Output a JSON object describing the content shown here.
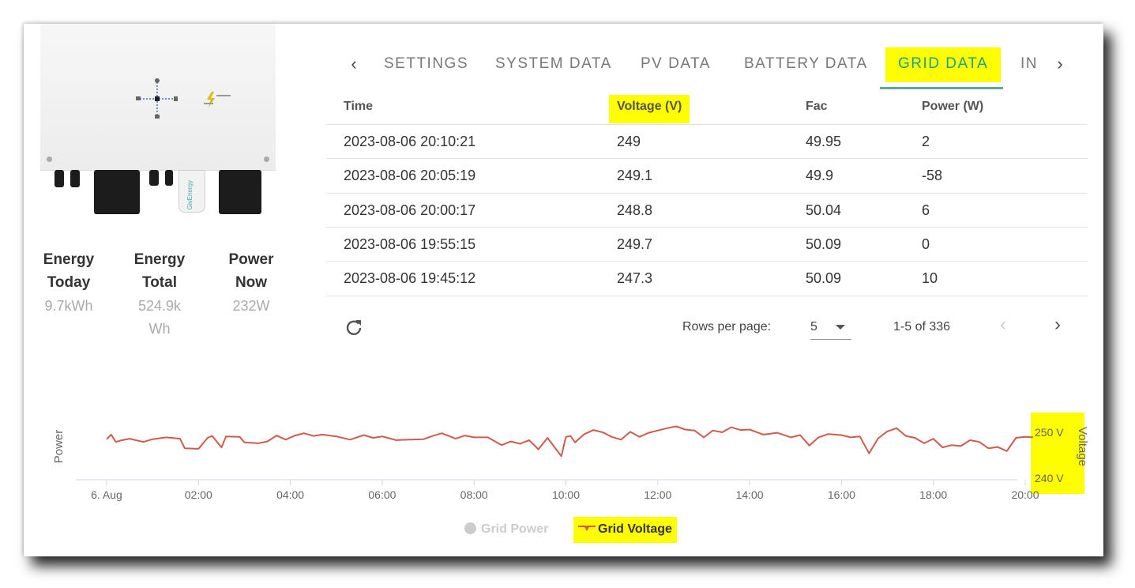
{
  "stats": [
    {
      "label_1": "Energy",
      "label_2": "Today",
      "value_1": "9.7kWh",
      "value_2": ""
    },
    {
      "label_1": "Energy",
      "label_2": "Total",
      "value_1": "524.9k",
      "value_2": "Wh"
    },
    {
      "label_1": "Power",
      "label_2": "Now",
      "value_1": "232W",
      "value_2": ""
    }
  ],
  "device": {
    "dongle_text": "GivEnergy"
  },
  "tabs": [
    "SETTINGS",
    "SYSTEM DATA",
    "PV DATA",
    "BATTERY DATA",
    "GRID DATA",
    "IN"
  ],
  "active_tab": "GRID DATA",
  "table": {
    "headers": [
      "Time",
      "Voltage (V)",
      "Fac",
      "Power (W)"
    ],
    "rows": [
      [
        "2023-08-06 20:10:21",
        "249",
        "49.95",
        "2"
      ],
      [
        "2023-08-06 20:05:19",
        "249.1",
        "49.9",
        "-58"
      ],
      [
        "2023-08-06 20:00:17",
        "248.8",
        "50.04",
        "6"
      ],
      [
        "2023-08-06 19:55:15",
        "249.7",
        "50.09",
        "0"
      ],
      [
        "2023-08-06 19:45:12",
        "247.3",
        "50.09",
        "10"
      ]
    ],
    "rows_per_page_label": "Rows per page:",
    "rows_per_page": "5",
    "range": "1-5 of 336"
  },
  "colors": {
    "accent": "#1aa391",
    "highlight": "#fffe00",
    "line": "#cd5c4f"
  },
  "chart_data": {
    "type": "line",
    "x_ticks": [
      "6. Aug",
      "02:00",
      "04:00",
      "06:00",
      "08:00",
      "10:00",
      "12:00",
      "14:00",
      "16:00",
      "18:00",
      "20:00"
    ],
    "y_left_label": "Power",
    "y_right_label": "Voltage",
    "y_right_ticks": [
      "250 V",
      "240 V"
    ],
    "y_right_range": [
      240,
      250
    ],
    "legend": [
      "Grid Power",
      "Grid Voltage"
    ],
    "series": [
      {
        "name": "Grid Voltage",
        "x_hours": [
          0,
          0.1,
          0.2,
          0.3,
          0.5,
          0.8,
          1,
          1.3,
          1.6,
          1.7,
          2.0,
          2.2,
          2.3,
          2.5,
          2.6,
          2.9,
          3.0,
          3.3,
          3.5,
          3.7,
          3.9,
          4.1,
          4.3,
          4.5,
          4.7,
          5.0,
          5.3,
          5.6,
          5.8,
          6.0,
          6.3,
          6.6,
          6.9,
          7.1,
          7.3,
          7.6,
          7.8,
          8.0,
          8.3,
          8.6,
          8.8,
          9.0,
          9.2,
          9.4,
          9.6,
          9.8,
          9.9,
          10.0,
          10.1,
          10.2,
          10.4,
          10.6,
          10.8,
          11.0,
          11.2,
          11.4,
          11.6,
          11.8,
          12.0,
          12.2,
          12.4,
          12.6,
          12.8,
          13.0,
          13.2,
          13.4,
          13.6,
          13.8,
          14.0,
          14.3,
          14.6,
          14.9,
          15.1,
          15.3,
          15.5,
          15.7,
          16.0,
          16.2,
          16.4,
          16.6,
          16.8,
          17.0,
          17.2,
          17.4,
          17.6,
          17.8,
          18.0,
          18.2,
          18.4,
          18.6,
          18.8,
          19.0,
          19.2,
          19.4,
          19.6,
          19.8,
          20.0,
          20.17
        ],
        "values": [
          248.5,
          249.5,
          247.9,
          248.2,
          248.6,
          247.9,
          248.5,
          248.9,
          248.6,
          246.5,
          246.4,
          248.8,
          249.2,
          246.7,
          249.1,
          249.0,
          247.8,
          247.6,
          248.0,
          249.3,
          248.4,
          249.3,
          249.8,
          249.2,
          249.5,
          249.1,
          248.4,
          249.4,
          248.8,
          249.1,
          248.3,
          248.4,
          248.5,
          249.2,
          249.8,
          248.6,
          249.3,
          248.9,
          248.9,
          247.2,
          248.0,
          247.5,
          248.3,
          246.3,
          248.8,
          246.1,
          244.8,
          249.0,
          249.2,
          247.8,
          249.6,
          250.5,
          250.0,
          249.0,
          248.4,
          250.1,
          249.0,
          249.9,
          250.4,
          250.9,
          251.3,
          250.6,
          250.4,
          248.9,
          250.4,
          250.0,
          251.1,
          250.5,
          250.6,
          249.5,
          249.9,
          248.9,
          249.4,
          247.1,
          248.9,
          249.6,
          249.4,
          248.9,
          249.1,
          245.4,
          248.7,
          250.2,
          250.9,
          249.2,
          248.8,
          247.6,
          248.6,
          246.7,
          247.2,
          247.0,
          248.3,
          247.9,
          246.5,
          246.8,
          245.9,
          248.8,
          249.0,
          248.9
        ]
      }
    ]
  }
}
